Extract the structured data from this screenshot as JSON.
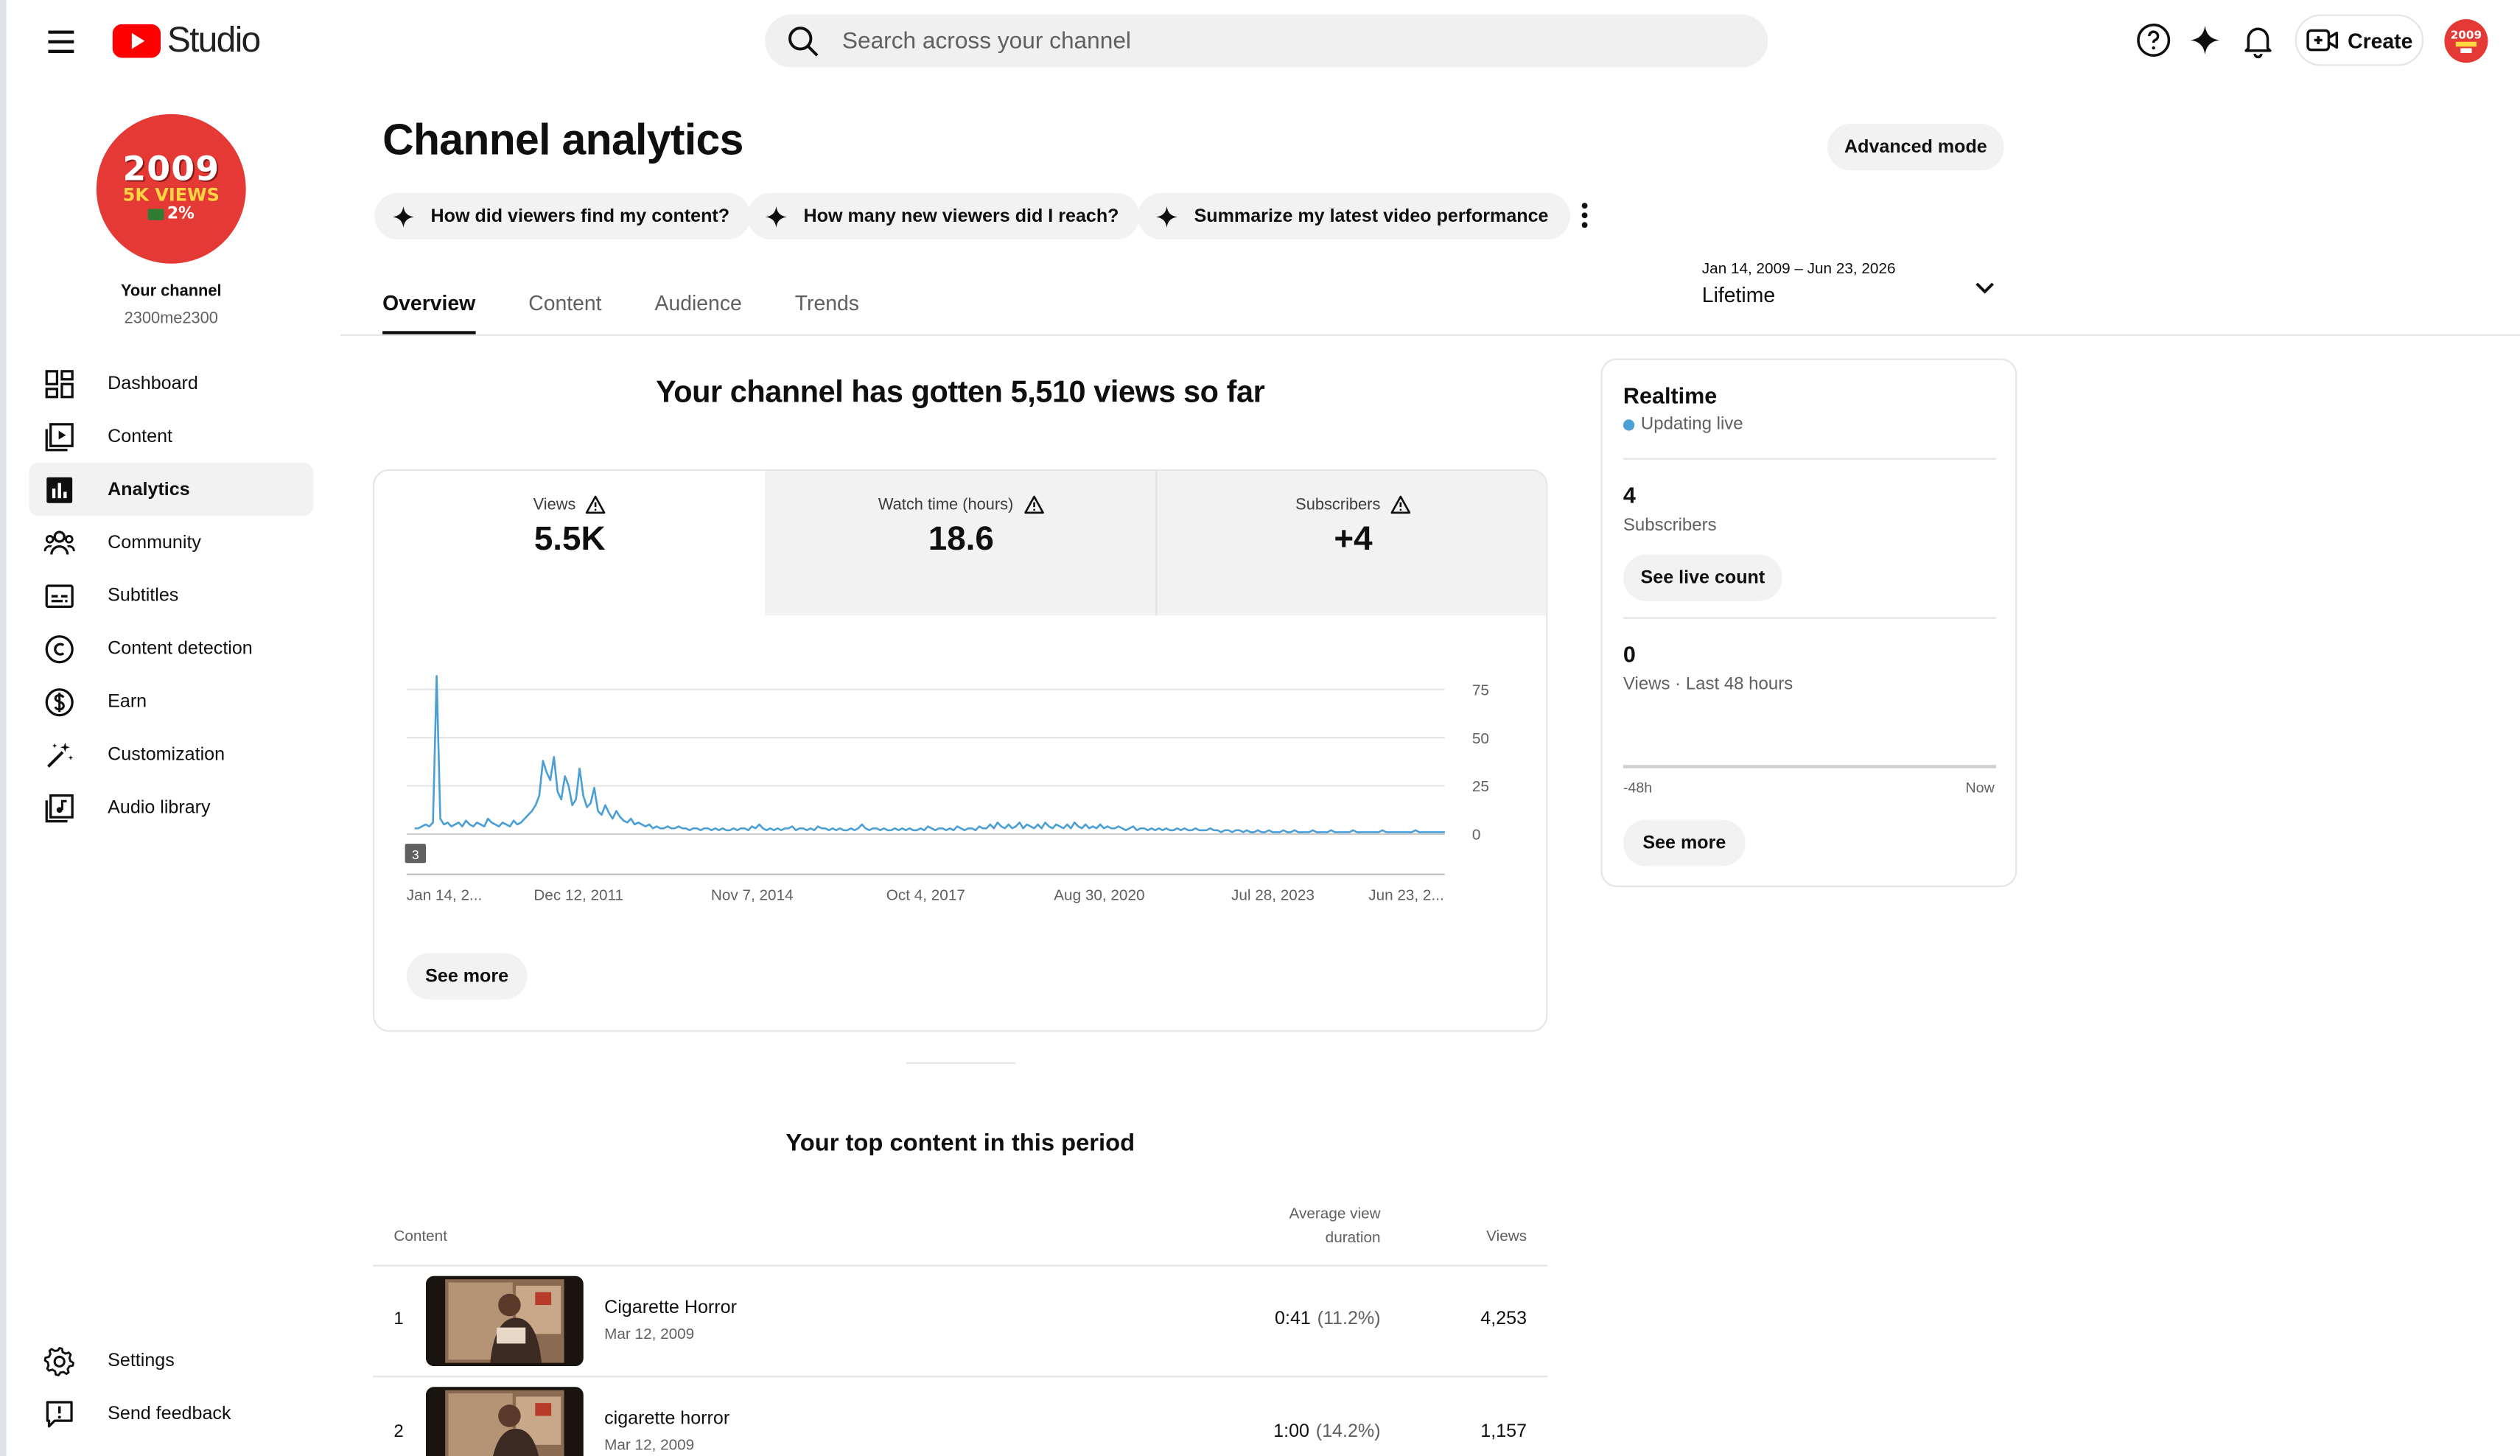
{
  "header": {
    "logo_text": "Studio",
    "search_placeholder": "Search across your channel",
    "create_label": "Create",
    "avatar_text": "2009 5K VIEWS 2%"
  },
  "sidebar": {
    "avatar": {
      "year": "2009",
      "views": "5K VIEWS",
      "pct": "2%"
    },
    "channel_label": "Your channel",
    "handle": "2300me2300",
    "items": [
      {
        "label": "Dashboard",
        "icon": "dashboard-icon"
      },
      {
        "label": "Content",
        "icon": "content-icon"
      },
      {
        "label": "Analytics",
        "icon": "analytics-icon",
        "active": true
      },
      {
        "label": "Community",
        "icon": "community-icon"
      },
      {
        "label": "Subtitles",
        "icon": "subtitles-icon"
      },
      {
        "label": "Content detection",
        "icon": "copyright-icon"
      },
      {
        "label": "Earn",
        "icon": "dollar-icon"
      },
      {
        "label": "Customization",
        "icon": "magic-wand-icon"
      },
      {
        "label": "Audio library",
        "icon": "audio-library-icon"
      }
    ],
    "bottom": [
      {
        "label": "Settings",
        "icon": "gear-icon"
      },
      {
        "label": "Send feedback",
        "icon": "feedback-icon"
      }
    ]
  },
  "page": {
    "title": "Channel analytics",
    "advanced_mode": "Advanced mode",
    "chips": [
      "How did viewers find my content?",
      "How many new viewers did I reach?",
      "Summarize my latest video performance"
    ],
    "tabs": [
      "Overview",
      "Content",
      "Audience",
      "Trends"
    ],
    "active_tab": "Overview",
    "date_range": {
      "sub": "Jan 14, 2009 – Jun 23, 2026",
      "main": "Lifetime"
    },
    "headline": "Your channel has gotten 5,510 views so far"
  },
  "metrics": [
    {
      "label": "Views",
      "value": "5.5K",
      "active": true
    },
    {
      "label": "Watch time (hours)",
      "value": "18.6",
      "active": false
    },
    {
      "label": "Subscribers",
      "value": "+4",
      "active": false
    }
  ],
  "chart_data": {
    "type": "line",
    "series": [
      {
        "values": [
          3,
          3,
          4,
          5,
          4,
          6,
          82,
          8,
          5,
          6,
          4,
          5,
          6,
          4,
          7,
          5,
          4,
          6,
          5,
          4,
          8,
          6,
          5,
          4,
          6,
          5,
          4,
          7,
          5,
          6,
          8,
          10,
          12,
          15,
          20,
          38,
          32,
          28,
          40,
          22,
          18,
          30,
          25,
          15,
          18,
          34,
          20,
          14,
          16,
          24,
          12,
          10,
          15,
          11,
          8,
          12,
          9,
          7,
          6,
          8,
          5,
          6,
          5,
          4,
          5,
          3,
          4,
          3,
          3,
          4,
          3,
          3,
          4,
          3,
          3,
          2,
          3,
          3,
          2,
          3,
          3,
          2,
          3,
          2,
          3,
          2,
          2,
          3,
          2,
          3,
          3,
          2,
          4,
          3,
          5,
          3,
          2,
          3,
          2,
          3,
          2,
          3,
          3,
          4,
          2,
          3,
          3,
          2,
          3,
          2,
          4,
          3,
          3,
          2,
          3,
          2,
          3,
          2,
          2,
          3,
          2,
          3,
          5,
          3,
          2,
          3,
          3,
          2,
          3,
          2,
          2,
          3,
          2,
          3,
          2,
          3,
          2,
          2,
          3,
          2,
          4,
          3,
          2,
          3,
          3,
          2,
          3,
          2,
          4,
          3,
          2,
          3,
          3,
          2,
          4,
          3,
          3,
          5,
          3,
          6,
          4,
          3,
          5,
          3,
          4,
          6,
          3,
          5,
          4,
          3,
          5,
          3,
          6,
          4,
          3,
          5,
          4,
          3,
          5,
          3,
          6,
          4,
          3,
          5,
          3,
          4,
          3,
          5,
          3,
          4,
          3,
          3,
          4,
          3,
          2,
          3,
          4,
          2,
          3,
          3,
          2,
          3,
          2,
          3,
          2,
          3,
          2,
          2,
          3,
          2,
          3,
          2,
          2,
          3,
          2,
          2,
          2,
          3,
          2,
          2,
          1,
          2,
          2,
          1,
          2,
          2,
          1,
          2,
          1,
          1,
          2,
          1,
          1,
          2,
          1,
          1,
          1,
          2,
          1,
          1,
          2,
          1,
          1,
          1,
          1,
          2,
          1,
          1,
          1,
          1,
          2,
          1,
          1,
          1,
          1,
          1,
          2,
          1,
          1,
          1,
          1,
          1,
          1,
          1,
          2,
          1,
          1,
          1,
          1,
          1,
          1,
          1,
          1,
          2,
          1,
          1,
          1,
          1,
          1,
          1,
          1,
          1
        ]
      }
    ],
    "x_tick_labels": [
      "Jan 14, 2...",
      "Dec 12, 2011",
      "Nov 7, 2014",
      "Oct 4, 2017",
      "Aug 30, 2020",
      "Jul 28, 2023",
      "Jun 23, 2..."
    ],
    "y_ticks": [
      0,
      25,
      50,
      75
    ],
    "ylim": [
      0,
      75
    ],
    "marker_label": "3",
    "grid": true,
    "line_color": "#4b9fd5"
  },
  "see_more_label": "See more",
  "top_content": {
    "title": "Your top content in this period",
    "col_content": "Content",
    "col_avd": "Average view duration",
    "col_views": "Views",
    "rows": [
      {
        "rank": "1",
        "title": "Cigarette Horror",
        "date": "Mar 12, 2009",
        "avd": "0:41",
        "avd_pct": "(11.2%)",
        "views": "4,253"
      },
      {
        "rank": "2",
        "title": "cigarette horror",
        "date": "Mar 12, 2009",
        "avd": "1:00",
        "avd_pct": "(14.2%)",
        "views": "1,157"
      }
    ]
  },
  "realtime": {
    "title": "Realtime",
    "status": "Updating live",
    "subscribers_value": "4",
    "subscribers_label": "Subscribers",
    "see_live_count": "See live count",
    "views_value": "0",
    "views_label": "Views · Last 48 hours",
    "axis_start": "-48h",
    "axis_end": "Now",
    "see_more": "See more"
  },
  "colors": {
    "brand_red": "#ff0000",
    "avatar_red": "#e53935",
    "chart_blue": "#4b9fd5"
  }
}
